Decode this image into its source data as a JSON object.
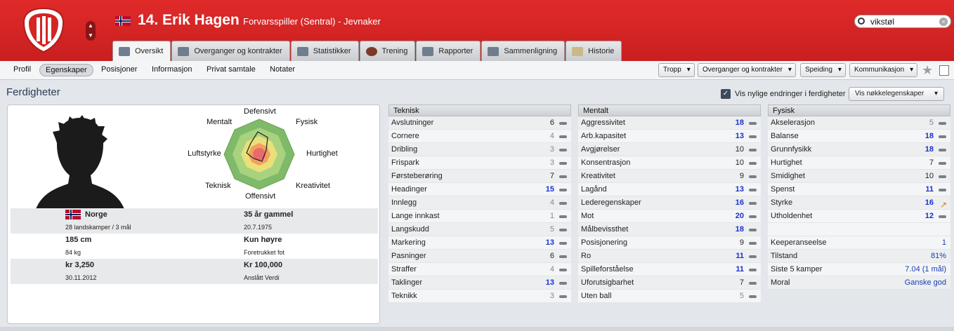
{
  "header": {
    "player_name": "14. Erik Hagen",
    "player_sub": "Forvarsspiller (Sentral) - Jevnaker",
    "search_value": "vikstøl",
    "nav_up": "▲",
    "nav_down": "▼",
    "brand_color": "#d42424"
  },
  "tabs": [
    {
      "label": "Oversikt",
      "icon": "overview-icon"
    },
    {
      "label": "Overganger og kontrakter",
      "icon": "document-icon"
    },
    {
      "label": "Statistikker",
      "icon": "stats-icon"
    },
    {
      "label": "Trening",
      "icon": "training-icon"
    },
    {
      "label": "Rapporter",
      "icon": "report-icon"
    },
    {
      "label": "Sammenligning",
      "icon": "compare-icon"
    },
    {
      "label": "Historie",
      "icon": "history-icon"
    }
  ],
  "subnav": {
    "items": [
      "Profil",
      "Egenskaper",
      "Posisjoner",
      "Informasjon",
      "Privat samtale",
      "Notater"
    ],
    "dropdowns": [
      "Tropp",
      "Overganger og kontrakter",
      "Speiding",
      "Kommunikasjon"
    ]
  },
  "section": {
    "title": "Ferdigheter",
    "checkbox_label": "Vis nylige endringer i ferdigheter",
    "key_attrs": "Vis nøkkelegenskaper"
  },
  "radar_labels": {
    "top": "Defensivt",
    "top_right": "Fysisk",
    "right": "Hurtighet",
    "bottom_right": "Kreativitet",
    "bottom": "Offensivt",
    "bottom_left": "Teknisk",
    "left": "Luftstyrke",
    "top_left": "Mentalt"
  },
  "profile": {
    "nationality": "Norge",
    "caps": "28 landskamper / 3 mål",
    "age": "35 år gammel",
    "dob": "20.7.1975",
    "height": "185 cm",
    "weight": "84 kg",
    "foot": "Kun høyre",
    "foot_label": "Foretrukket fot",
    "wage": "kr 3,250",
    "contract": "30.11.2012",
    "value": "Kr 100,000",
    "value_label": "Anslått Verdi"
  },
  "teknisk": {
    "title": "Teknisk",
    "rows": [
      {
        "name": "Avslutninger",
        "value": "6",
        "tier": "mid"
      },
      {
        "name": "Cornere",
        "value": "4",
        "tier": "lo"
      },
      {
        "name": "Dribling",
        "value": "3",
        "tier": "lo"
      },
      {
        "name": "Frispark",
        "value": "3",
        "tier": "lo"
      },
      {
        "name": "Førsteberøring",
        "value": "7",
        "tier": "mid"
      },
      {
        "name": "Headinger",
        "value": "15",
        "tier": "hi"
      },
      {
        "name": "Innlegg",
        "value": "4",
        "tier": "lo"
      },
      {
        "name": "Lange innkast",
        "value": "1",
        "tier": "lo"
      },
      {
        "name": "Langskudd",
        "value": "5",
        "tier": "lo"
      },
      {
        "name": "Markering",
        "value": "13",
        "tier": "hi"
      },
      {
        "name": "Pasninger",
        "value": "6",
        "tier": "mid"
      },
      {
        "name": "Straffer",
        "value": "4",
        "tier": "lo"
      },
      {
        "name": "Taklinger",
        "value": "13",
        "tier": "hi"
      },
      {
        "name": "Teknikk",
        "value": "3",
        "tier": "lo"
      }
    ]
  },
  "mentalt": {
    "title": "Mentalt",
    "rows": [
      {
        "name": "Aggressivitet",
        "value": "18",
        "tier": "hi"
      },
      {
        "name": "Arb.kapasitet",
        "value": "13",
        "tier": "hi"
      },
      {
        "name": "Avgjørelser",
        "value": "10",
        "tier": "mid"
      },
      {
        "name": "Konsentrasjon",
        "value": "10",
        "tier": "mid"
      },
      {
        "name": "Kreativitet",
        "value": "9",
        "tier": "mid"
      },
      {
        "name": "Lagånd",
        "value": "13",
        "tier": "hi"
      },
      {
        "name": "Lederegenskaper",
        "value": "16",
        "tier": "hi"
      },
      {
        "name": "Mot",
        "value": "20",
        "tier": "hi"
      },
      {
        "name": "Målbevissthet",
        "value": "18",
        "tier": "hi"
      },
      {
        "name": "Posisjonering",
        "value": "9",
        "tier": "mid"
      },
      {
        "name": "Ro",
        "value": "11",
        "tier": "hi"
      },
      {
        "name": "Spilleforståelse",
        "value": "11",
        "tier": "hi"
      },
      {
        "name": "Uforutsigbarhet",
        "value": "7",
        "tier": "mid"
      },
      {
        "name": "Uten ball",
        "value": "5",
        "tier": "lo"
      }
    ]
  },
  "fysisk": {
    "title": "Fysisk",
    "rows": [
      {
        "name": "Akselerasjon",
        "value": "5",
        "tier": "lo"
      },
      {
        "name": "Balanse",
        "value": "18",
        "tier": "hi"
      },
      {
        "name": "Grunnfysikk",
        "value": "18",
        "tier": "hi"
      },
      {
        "name": "Hurtighet",
        "value": "7",
        "tier": "mid"
      },
      {
        "name": "Smidighet",
        "value": "10",
        "tier": "mid"
      },
      {
        "name": "Spenst",
        "value": "11",
        "tier": "hi"
      },
      {
        "name": "Styrke",
        "value": "16",
        "tier": "hi",
        "trend": "up"
      },
      {
        "name": "Utholdenhet",
        "value": "12",
        "tier": "hi"
      }
    ],
    "extra": [
      {
        "name": "Keeperanseelse",
        "value": "1"
      },
      {
        "name": "Tilstand",
        "value": "81%"
      },
      {
        "name": "Siste 5 kamper",
        "value": "7.04 (1 mål)"
      },
      {
        "name": "Moral",
        "value": "Ganske god"
      }
    ]
  }
}
